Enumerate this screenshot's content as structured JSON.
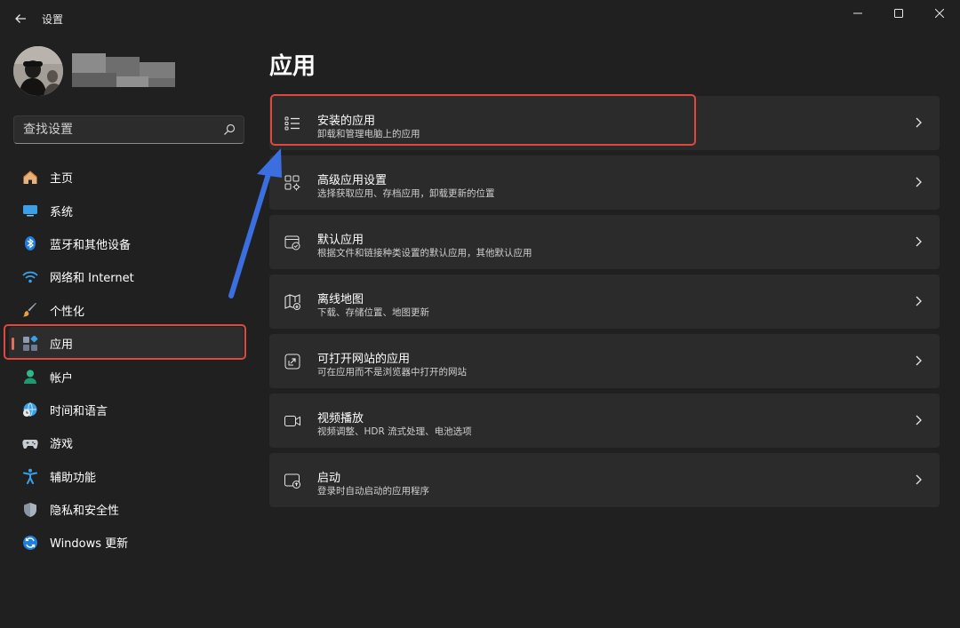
{
  "window": {
    "title": "设置"
  },
  "search": {
    "placeholder": "查找设置"
  },
  "nav": {
    "items": [
      {
        "label": "主页",
        "icon": "home-icon"
      },
      {
        "label": "系统",
        "icon": "system-icon"
      },
      {
        "label": "蓝牙和其他设备",
        "icon": "bluetooth-icon"
      },
      {
        "label": "网络和 Internet",
        "icon": "wifi-icon"
      },
      {
        "label": "个性化",
        "icon": "brush-icon"
      },
      {
        "label": "应用",
        "icon": "apps-icon",
        "active": true
      },
      {
        "label": "帐户",
        "icon": "account-icon"
      },
      {
        "label": "时间和语言",
        "icon": "clock-globe-icon"
      },
      {
        "label": "游戏",
        "icon": "gamepad-icon"
      },
      {
        "label": "辅助功能",
        "icon": "accessibility-icon"
      },
      {
        "label": "隐私和安全性",
        "icon": "shield-icon"
      },
      {
        "label": "Windows 更新",
        "icon": "update-icon"
      }
    ]
  },
  "main": {
    "title": "应用",
    "cards": [
      {
        "title": "安装的应用",
        "desc": "卸载和管理电脑上的应用",
        "icon": "list-icon"
      },
      {
        "title": "高级应用设置",
        "desc": "选择获取应用、存档应用，卸载更新的位置",
        "icon": "app-settings-icon"
      },
      {
        "title": "默认应用",
        "desc": "根据文件和链接种类设置的默认应用，其他默认应用",
        "icon": "default-apps-icon"
      },
      {
        "title": "离线地图",
        "desc": "下载、存储位置、地图更新",
        "icon": "map-icon"
      },
      {
        "title": "可打开网站的应用",
        "desc": "可在应用而不是浏览器中打开的网站",
        "icon": "open-external-icon"
      },
      {
        "title": "视频播放",
        "desc": "视频调整、HDR 流式处理、电池选项",
        "icon": "video-icon"
      },
      {
        "title": "启动",
        "desc": "登录时自动启动的应用程序",
        "icon": "startup-icon"
      }
    ]
  },
  "colors": {
    "background": "#202020",
    "card": "#2b2b2b",
    "accent_nav": "#e56d5e",
    "highlight_box": "#e0483e",
    "annotation_arrow": "#3b6fe0"
  }
}
